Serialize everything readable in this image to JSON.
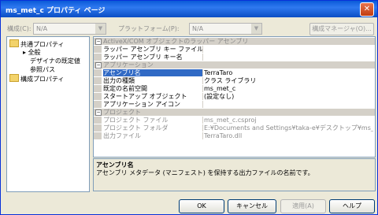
{
  "window": {
    "title": "ms_met_c プロパティ ページ",
    "close_glyph": "✕"
  },
  "toolbar": {
    "config_label": "構成(C):",
    "config_value": "N/A",
    "platform_label": "プラットフォーム(P):",
    "platform_value": "N/A",
    "config_manager_label": "構成マネージャ(O)..."
  },
  "tree": {
    "items": [
      {
        "label": "共通プロパティ"
      },
      {
        "label": "全般"
      },
      {
        "label": "デザイナの既定値"
      },
      {
        "label": "参照パス"
      },
      {
        "label": "構成プロパティ"
      }
    ]
  },
  "grid": {
    "cat1": "ActiveX/COM オブジェクトのラッパー アセンブリ",
    "r1_name": "ラッパー アセンブリ キー ファイル",
    "r1_val": "",
    "r2_name": "ラッパー アセンブリ キー名",
    "r2_val": "",
    "cat2": "アプリケーション",
    "r3_name": "アセンブリ名",
    "r3_val": "TerraTaro",
    "r4_name": "出力の種類",
    "r4_val": "クラス ライブラリ",
    "r5_name": "既定の名前空間",
    "r5_val": "ms_met_c",
    "r6_name": "スタートアップ オブジェクト",
    "r6_val": "(設定なし)",
    "r7_name": "アプリケーション アイコン",
    "r7_val": "",
    "cat3": "プロジェクト",
    "r8_name": "プロジェクト ファイル",
    "r8_val": "ms_met_c.csproj",
    "r9_name": "プロジェクト フォルダ",
    "r9_val": "E:¥Documents and Settings¥taka-e¥デスクトップ¥ms_",
    "r10_name": "出力ファイル",
    "r10_val": "TerraTaro.dll"
  },
  "description": {
    "title": "アセンブリ名",
    "text": "アセンブリ メタデータ (マニフェスト) を保持する出力ファイルの名前です。"
  },
  "buttons": {
    "ok": "OK",
    "cancel": "キャンセル",
    "apply": "適用(A)",
    "help": "ヘルプ"
  }
}
